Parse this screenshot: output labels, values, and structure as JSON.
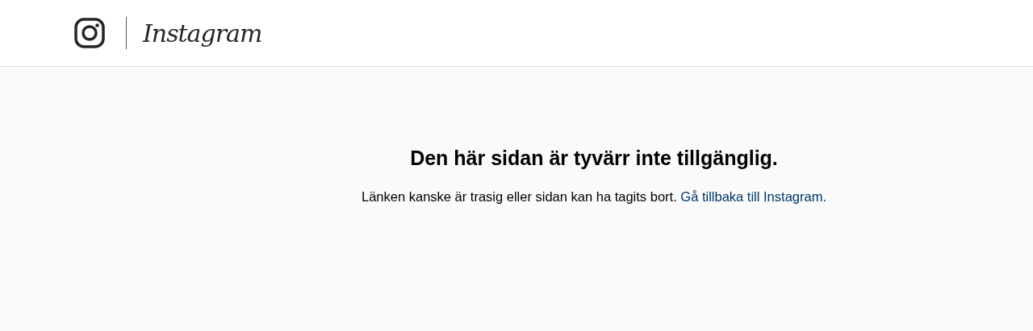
{
  "header": {
    "logo_text": "Instagram"
  },
  "message": {
    "title": "Den här sidan är tyvärr inte tillgänglig.",
    "text": "Länken kanske är trasig eller sidan kan ha tagits bort.",
    "link": "Gå tillbaka till Instagram."
  }
}
